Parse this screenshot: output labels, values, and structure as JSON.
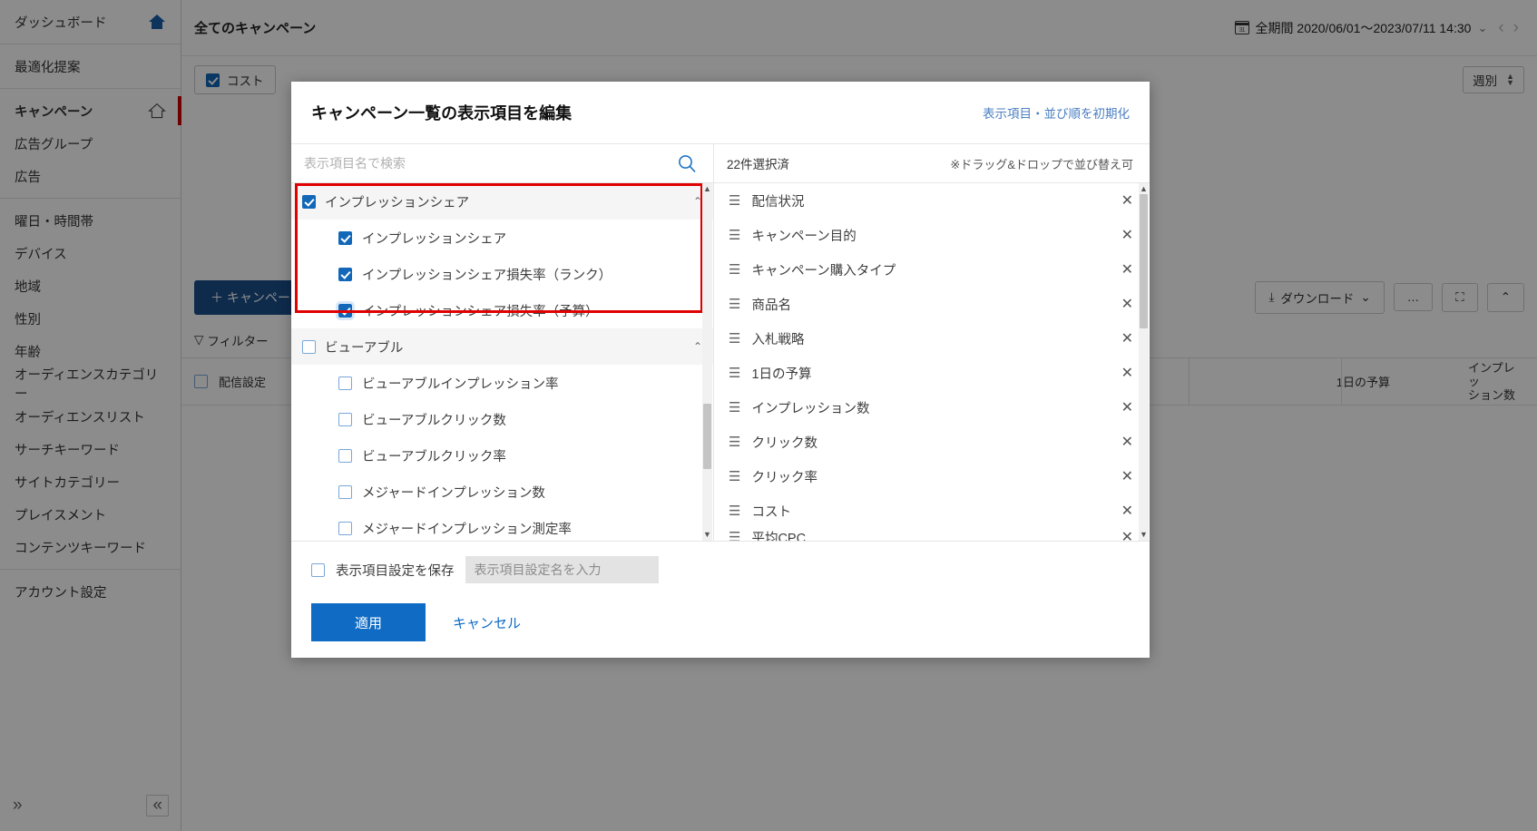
{
  "sidebar": {
    "groups": [
      {
        "items": [
          {
            "label": "ダッシュボード",
            "icon": "home-filled-icon",
            "active": false
          }
        ]
      },
      {
        "items": [
          {
            "label": "最適化提案",
            "icon": "",
            "active": false
          }
        ]
      },
      {
        "items": [
          {
            "label": "キャンペーン",
            "icon": "home-outline-icon",
            "active": true
          },
          {
            "label": "広告グループ",
            "icon": "",
            "active": false
          },
          {
            "label": "広告",
            "icon": "",
            "active": false
          }
        ]
      },
      {
        "items": [
          {
            "label": "曜日・時間帯",
            "icon": "",
            "active": false
          },
          {
            "label": "デバイス",
            "icon": "",
            "active": false
          },
          {
            "label": "地域",
            "icon": "",
            "active": false
          },
          {
            "label": "性別",
            "icon": "",
            "active": false
          },
          {
            "label": "年齢",
            "icon": "",
            "active": false
          },
          {
            "label": "オーディエンスカテゴリー",
            "icon": "",
            "active": false
          },
          {
            "label": "オーディエンスリスト",
            "icon": "",
            "active": false
          },
          {
            "label": "サーチキーワード",
            "icon": "",
            "active": false
          },
          {
            "label": "サイトカテゴリー",
            "icon": "",
            "active": false
          },
          {
            "label": "プレイスメント",
            "icon": "",
            "active": false
          },
          {
            "label": "コンテンツキーワード",
            "icon": "",
            "active": false
          }
        ]
      },
      {
        "items": [
          {
            "label": "アカウント設定",
            "icon": "",
            "active": false
          }
        ]
      }
    ],
    "expand_right_icon": "»",
    "collapse_left_icon": "«"
  },
  "topbar": {
    "title": "全てのキャンペーン",
    "calendar_icon": "calendar-icon",
    "date_range": "全期間 2020/06/01〜2023/07/11 14:30",
    "chevron": "⌄",
    "prev_icon": "‹",
    "next_icon": "›"
  },
  "metrics_bar": {
    "chip_label": "コスト",
    "chip_checked": true,
    "interval_label": "週別"
  },
  "action_bar": {
    "add_campaign_label": "＋ キャンペーン",
    "download_label": "ダウンロード",
    "download_icon": "download-icon",
    "more_icon": "…",
    "fullscreen_icon": "expand-icon",
    "collapse_icon": "⌃"
  },
  "filter_bar": {
    "filter_icon": "filter-icon",
    "label": "フィルター"
  },
  "table": {
    "headers": [
      "配信設定",
      "1日の予算",
      "インプレッション数"
    ]
  },
  "modal": {
    "title": "キャンペーン一覧の表示項目を編集",
    "reset_link": "表示項目・並び順を初期化",
    "search_placeholder": "表示項目名で検索",
    "search_value": "",
    "search_icon": "search-icon",
    "selected_count": "22件選択済",
    "drag_note": "※ドラッグ&ドロップで並び替え可",
    "left_options": [
      {
        "label": "インプレッションシェア",
        "checked": true,
        "level": "group",
        "caret": "⌃"
      },
      {
        "label": "インプレッションシェア",
        "checked": true,
        "level": "child"
      },
      {
        "label": "インプレッションシェア損失率（ランク）",
        "checked": true,
        "level": "child"
      },
      {
        "label": "インプレッションシェア損失率（予算）",
        "checked": true,
        "level": "child"
      },
      {
        "label": "ビューアブル",
        "checked": false,
        "level": "group",
        "caret": "⌃"
      },
      {
        "label": "ビューアブルインプレッション率",
        "checked": false,
        "level": "child"
      },
      {
        "label": "ビューアブルクリック数",
        "checked": false,
        "level": "child"
      },
      {
        "label": "ビューアブルクリック率",
        "checked": false,
        "level": "child"
      },
      {
        "label": "メジャードインプレッション数",
        "checked": false,
        "level": "child"
      },
      {
        "label": "メジャードインプレッション測定率",
        "checked": false,
        "level": "child"
      }
    ],
    "selected_items": [
      {
        "label": "配信状況"
      },
      {
        "label": "キャンペーン目的"
      },
      {
        "label": "キャンペーン購入タイプ"
      },
      {
        "label": "商品名"
      },
      {
        "label": "入札戦略"
      },
      {
        "label": "1日の予算"
      },
      {
        "label": "インプレッション数"
      },
      {
        "label": "クリック数"
      },
      {
        "label": "クリック率"
      },
      {
        "label": "コスト"
      },
      {
        "label": "平均CPC"
      }
    ],
    "remove_icon": "✕",
    "grip_icon": "drag-handle-icon",
    "scroll_up_icon": "▲",
    "scroll_down_icon": "▼",
    "save_checkbox_label": "表示項目設定を保存",
    "save_checkbox_checked": false,
    "save_name_placeholder": "表示項目設定名を入力",
    "save_name_value": "",
    "apply_label": "適用",
    "cancel_label": "キャンセル"
  },
  "colors": {
    "accent_blue": "#0f6bc4",
    "dark_blue": "#1a4f8a",
    "link_blue": "#4a7fc1",
    "highlight_red": "#e00000"
  }
}
